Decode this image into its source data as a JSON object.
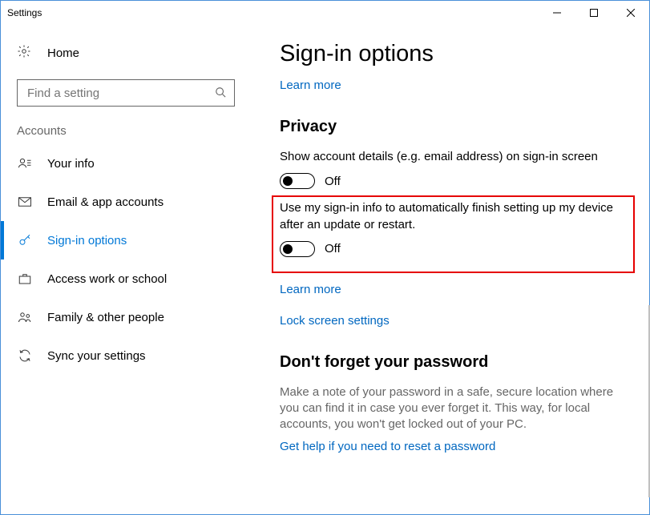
{
  "window": {
    "title": "Settings"
  },
  "sidebar": {
    "home_label": "Home",
    "search_placeholder": "Find a setting",
    "section_label": "Accounts",
    "items": [
      {
        "label": "Your info"
      },
      {
        "label": "Email & app accounts"
      },
      {
        "label": "Sign-in options"
      },
      {
        "label": "Access work or school"
      },
      {
        "label": "Family & other people"
      },
      {
        "label": "Sync your settings"
      }
    ]
  },
  "main": {
    "heading": "Sign-in options",
    "learn_more": "Learn more",
    "privacy_heading": "Privacy",
    "toggle1_text": "Show account details (e.g. email address) on sign-in screen",
    "toggle1_state": "Off",
    "toggle2_text": "Use my sign-in info to automatically finish setting up my device after an update or restart.",
    "toggle2_state": "Off",
    "learn_more2": "Learn more",
    "lock_screen_link": "Lock screen settings",
    "password_heading": "Don't forget your password",
    "password_hint": "Make a note of your password in a safe, secure location where you can find it in case you ever forget it. This way, for local accounts, you won't get locked out of your PC.",
    "reset_link": "Get help if you need to reset a password"
  }
}
